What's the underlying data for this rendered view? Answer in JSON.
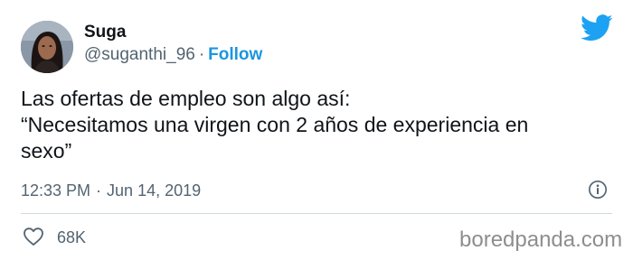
{
  "author": {
    "name": "Suga",
    "handle": "@suganthi_96",
    "separator": "·",
    "follow_label": "Follow"
  },
  "tweet": {
    "lines": [
      "Las ofertas de empleo son algo así:",
      "“Necesitamos una virgen con 2 años de experiencia en",
      "sexo”"
    ],
    "time": "12:33 PM",
    "separator": "·",
    "date": "Jun 14, 2019",
    "likes": "68K"
  },
  "icons": {
    "brand": "twitter-bird-icon",
    "info": "info-icon",
    "like": "heart-icon"
  },
  "colors": {
    "accent": "#1b95e0",
    "twitter_blue": "#1da1f2",
    "secondary_text": "#536471",
    "divider": "#cfd9de"
  },
  "watermark": "boredpanda.com"
}
